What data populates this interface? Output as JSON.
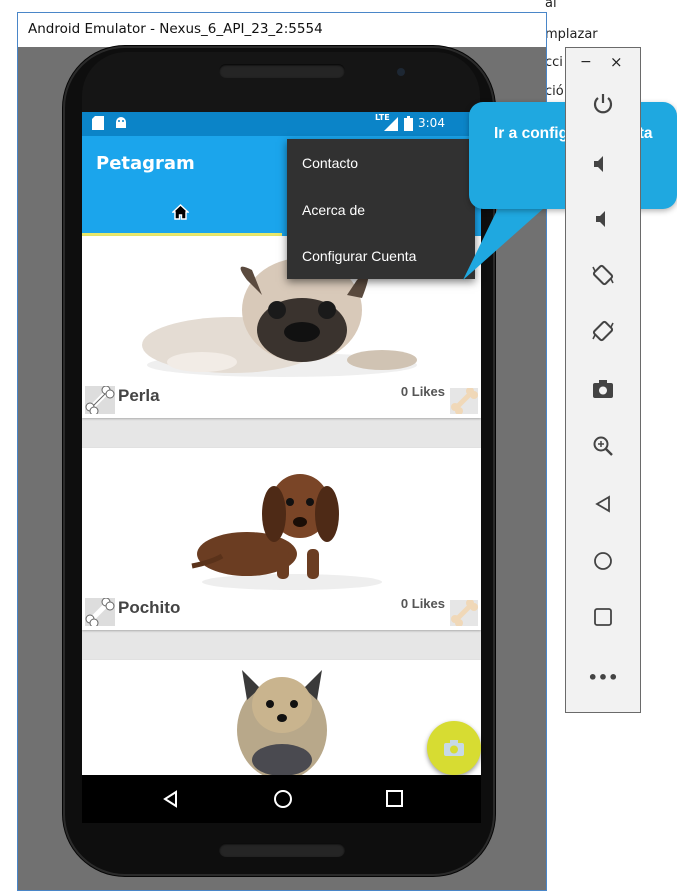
{
  "background_window": {
    "snippets": [
      "al",
      "mplazar",
      "cci",
      "ció"
    ]
  },
  "emulator": {
    "title": "Android Emulator - Nexus_6_API_23_2:5554"
  },
  "statusbar": {
    "network": "LTE",
    "time": "3:04"
  },
  "app": {
    "title": "Petagram",
    "tabs": [
      {
        "icon": "home-icon",
        "selected": true
      }
    ],
    "accent_color": "#1ba5ec",
    "statusbar_color": "#0b84c8",
    "tab_indicator_color": "#e9e86a"
  },
  "overflow_menu": {
    "items": [
      {
        "label": "Contacto"
      },
      {
        "label": "Acerca de"
      },
      {
        "label": "Configurar Cuenta"
      }
    ]
  },
  "pets": [
    {
      "name": "Perla",
      "likes": "0 Likes"
    },
    {
      "name": "Pochito",
      "likes": "0 Likes"
    },
    {
      "name": "",
      "likes": ""
    }
  ],
  "fab": {
    "icon": "camera-icon",
    "color": "#d7dc32"
  },
  "navbar": {
    "buttons": [
      "back-icon",
      "home-icon",
      "recents-icon"
    ]
  },
  "callout": {
    "text": "Ir a configurar cuenta",
    "color": "#1fa8e0"
  },
  "emulator_toolbar": {
    "buttons": [
      "minimize-icon",
      "close-icon",
      "power-icon",
      "volume-up-icon",
      "volume-down-icon",
      "rotate-left-icon",
      "rotate-right-icon",
      "screenshot-icon",
      "zoom-icon",
      "back-icon",
      "home-icon",
      "overview-icon",
      "more-icon"
    ]
  }
}
